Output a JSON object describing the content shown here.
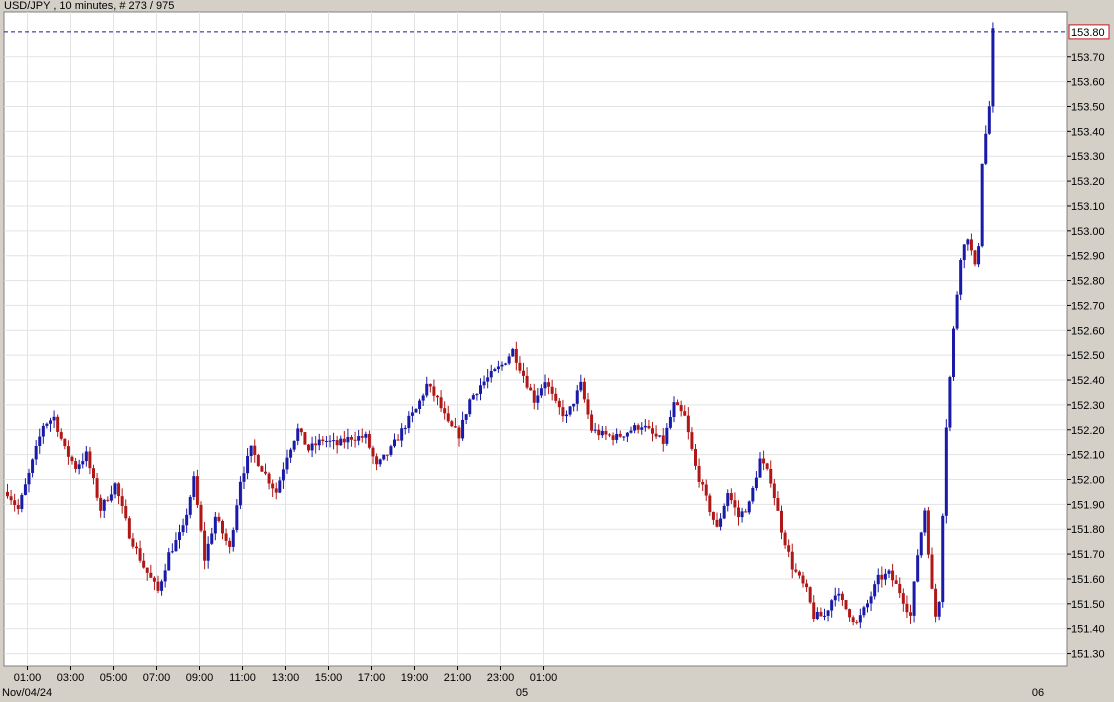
{
  "header": {
    "symbol": "USD/JPY",
    "interval": " , 10 minutes, # 273 / 975"
  },
  "colors": {
    "background": "#d4d0c8",
    "plot": "#ffffff",
    "grid": "#e3e3e3",
    "up": "#1a1aa8",
    "down": "#b01818",
    "price_line": "#1a1a8a",
    "price_box": "#c01818"
  },
  "chart_data": {
    "type": "candlestick",
    "ylim": [
      151.25,
      153.88
    ],
    "y_ticks": [
      "153.70",
      "153.60",
      "153.50",
      "153.40",
      "153.30",
      "153.20",
      "153.10",
      "153.00",
      "152.90",
      "152.80",
      "152.70",
      "152.60",
      "152.50",
      "152.40",
      "152.30",
      "152.20",
      "152.10",
      "152.00",
      "151.90",
      "151.80",
      "151.70",
      "151.60",
      "151.50",
      "151.40",
      "151.30"
    ],
    "current_price": "153.80",
    "x_ticks": [
      "01:00",
      "03:00",
      "05:00",
      "07:00",
      "09:00",
      "11:00",
      "13:00",
      "15:00",
      "17:00",
      "19:00",
      "21:00",
      "23:00",
      "01:00"
    ],
    "x_dates": [
      "Nov/04/24",
      "05",
      "06"
    ],
    "anchors": [
      [
        "00:00",
        151.95
      ],
      [
        "00:30",
        151.88
      ],
      [
        "01:00",
        152.02
      ],
      [
        "01:40",
        152.22
      ],
      [
        "02:10",
        152.25
      ],
      [
        "02:40",
        152.12
      ],
      [
        "03:10",
        152.05
      ],
      [
        "03:40",
        152.1
      ],
      [
        "04:20",
        151.88
      ],
      [
        "05:00",
        151.98
      ],
      [
        "05:40",
        151.78
      ],
      [
        "06:20",
        151.65
      ],
      [
        "07:00",
        151.55
      ],
      [
        "07:30",
        151.7
      ],
      [
        "08:10",
        151.8
      ],
      [
        "08:40",
        152.0
      ],
      [
        "09:10",
        151.68
      ],
      [
        "09:40",
        151.85
      ],
      [
        "10:20",
        151.72
      ],
      [
        "10:50",
        152.0
      ],
      [
        "11:20",
        152.12
      ],
      [
        "12:00",
        152.02
      ],
      [
        "12:30",
        151.95
      ],
      [
        "13:00",
        152.1
      ],
      [
        "13:30",
        152.2
      ],
      [
        "14:00",
        152.12
      ],
      [
        "14:40",
        152.16
      ],
      [
        "15:20",
        152.14
      ],
      [
        "16:00",
        152.17
      ],
      [
        "16:40",
        152.17
      ],
      [
        "17:10",
        152.05
      ],
      [
        "17:50",
        152.12
      ],
      [
        "18:30",
        152.22
      ],
      [
        "19:00",
        152.28
      ],
      [
        "19:30",
        152.38
      ],
      [
        "20:00",
        152.32
      ],
      [
        "20:30",
        152.22
      ],
      [
        "21:00",
        152.18
      ],
      [
        "21:30",
        152.32
      ],
      [
        "22:00",
        152.38
      ],
      [
        "22:30",
        152.42
      ],
      [
        "23:00",
        152.46
      ],
      [
        "23:30",
        152.52
      ],
      [
        "00:00",
        152.42
      ],
      [
        "00:30",
        152.32
      ],
      [
        "01:00",
        152.4
      ],
      [
        "01:30",
        152.3
      ],
      [
        "02:00",
        152.25
      ],
      [
        "02:40",
        152.38
      ],
      [
        "03:10",
        152.2
      ],
      [
        "03:40",
        152.18
      ],
      [
        "04:20",
        152.17
      ],
      [
        "05:00",
        152.2
      ],
      [
        "05:30",
        152.22
      ],
      [
        "06:00",
        152.18
      ],
      [
        "06:30",
        152.15
      ],
      [
        "07:00",
        152.3
      ],
      [
        "07:30",
        152.25
      ],
      [
        "08:00",
        152.05
      ],
      [
        "08:30",
        151.92
      ],
      [
        "09:00",
        151.8
      ],
      [
        "09:30",
        151.95
      ],
      [
        "10:00",
        151.85
      ],
      [
        "10:30",
        151.9
      ],
      [
        "11:00",
        152.08
      ],
      [
        "11:30",
        152.0
      ],
      [
        "12:00",
        151.8
      ],
      [
        "12:30",
        151.65
      ],
      [
        "13:10",
        151.55
      ],
      [
        "13:30",
        151.45
      ],
      [
        "14:00",
        151.45
      ],
      [
        "14:30",
        151.55
      ],
      [
        "15:00",
        151.48
      ],
      [
        "15:30",
        151.42
      ],
      [
        "16:00",
        151.5
      ],
      [
        "16:30",
        151.6
      ],
      [
        "17:00",
        151.62
      ],
      [
        "17:30",
        151.55
      ],
      [
        "18:00",
        151.45
      ],
      [
        "18:20",
        151.7
      ],
      [
        "18:40",
        151.88
      ],
      [
        "19:00",
        151.55
      ],
      [
        "19:10",
        151.45
      ],
      [
        "19:20",
        151.52
      ],
      [
        "19:40",
        152.22
      ],
      [
        "20:00",
        152.6
      ],
      [
        "20:20",
        152.9
      ],
      [
        "20:40",
        152.98
      ],
      [
        "21:00",
        152.85
      ],
      [
        "21:10",
        152.95
      ],
      [
        "21:20",
        153.28
      ],
      [
        "21:40",
        153.5
      ],
      [
        "21:50",
        153.8
      ]
    ]
  }
}
